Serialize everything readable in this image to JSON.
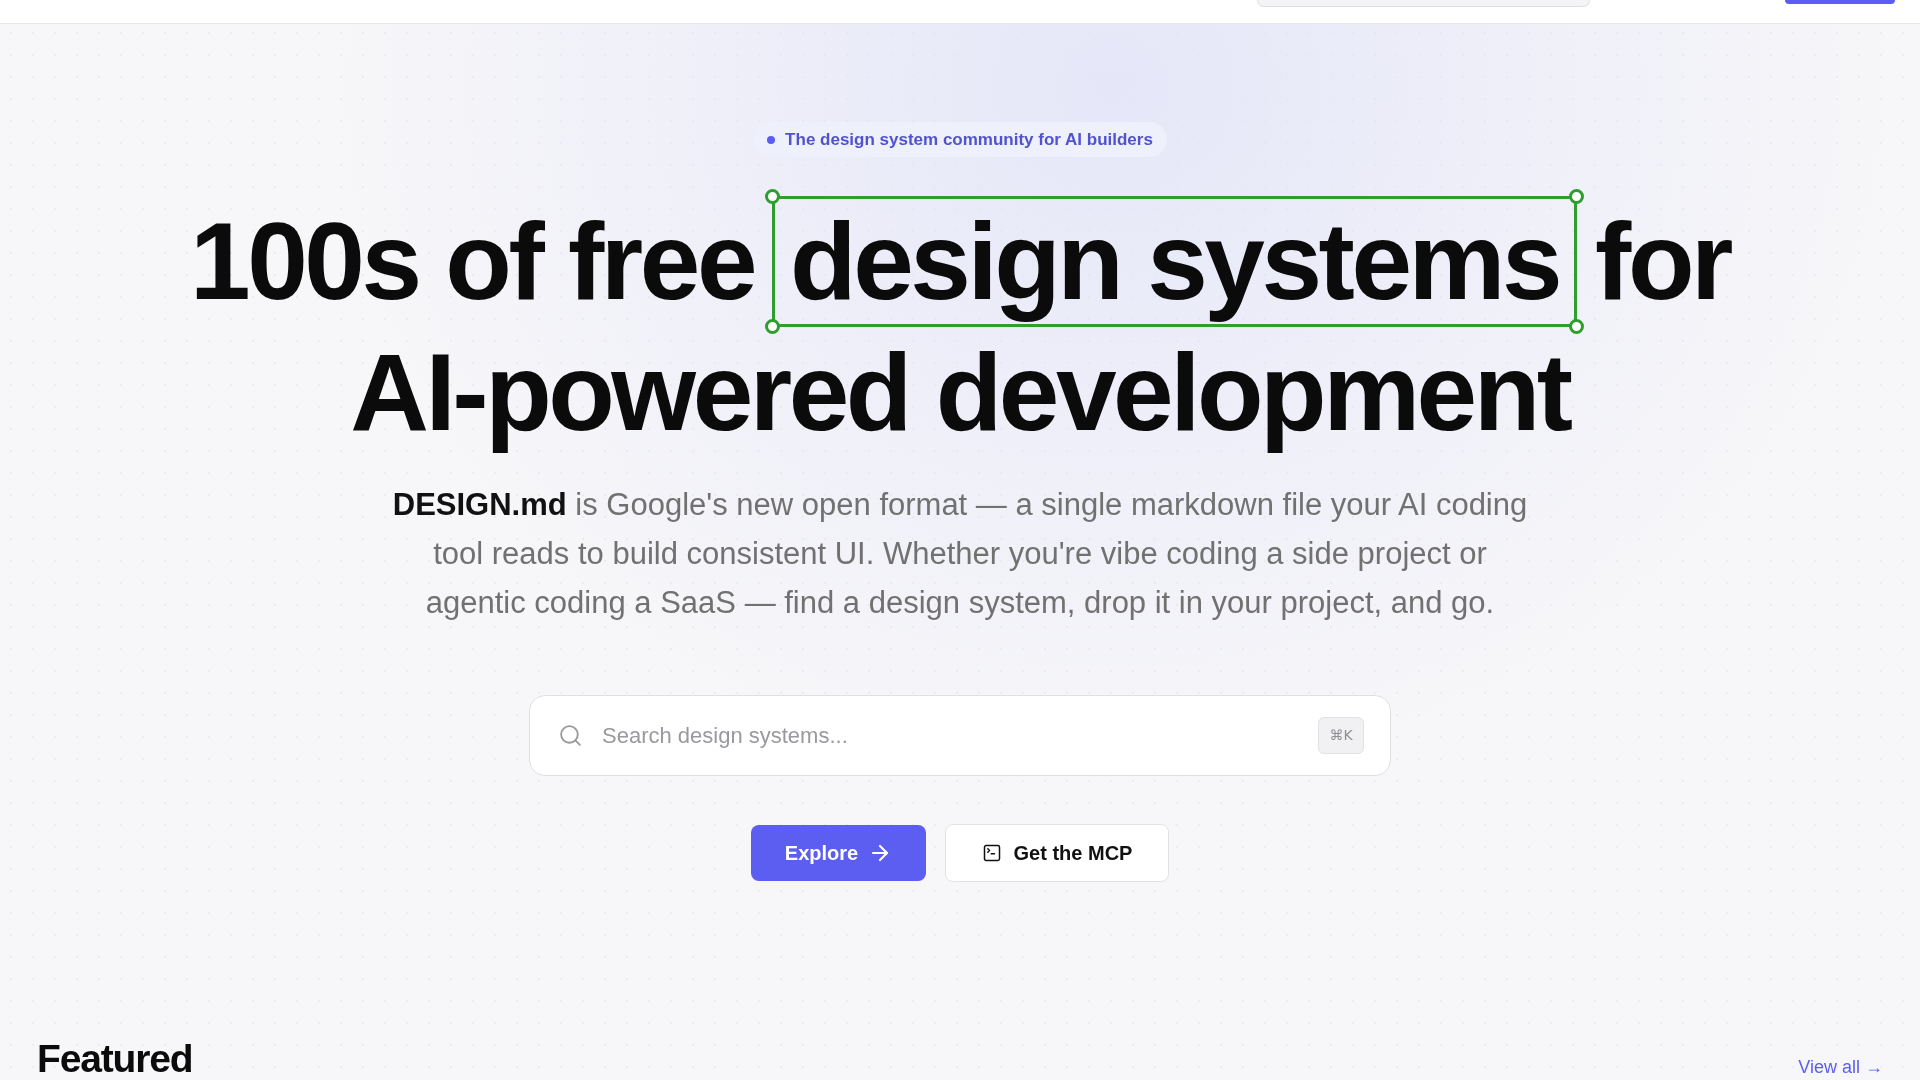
{
  "badge": {
    "text": "The design system community for AI builders"
  },
  "headline": {
    "lines": [
      [
        {
          "text": "100s of free",
          "selected": false
        },
        {
          "text": "design systems",
          "selected": true
        },
        {
          "text": "for",
          "selected": false
        }
      ],
      [
        {
          "text": "AI-powered development",
          "selected": false
        }
      ]
    ]
  },
  "description": "**DESIGN.md** is Google's new open format — a single markdown file your AI coding tool reads to build consistent UI. Whether you're vibe coding a side project or agentic coding a SaaS — find a design system, drop it in your project, and go.",
  "search": {
    "placeholder": "Search design systems...",
    "shortcut": "⌘K"
  },
  "actions": [
    {
      "label": "Explore",
      "kind": "primary"
    },
    {
      "label": "Get the MCP",
      "kind": "secondary"
    }
  ],
  "featured": {
    "title": "Featured",
    "link": "View all →"
  }
}
